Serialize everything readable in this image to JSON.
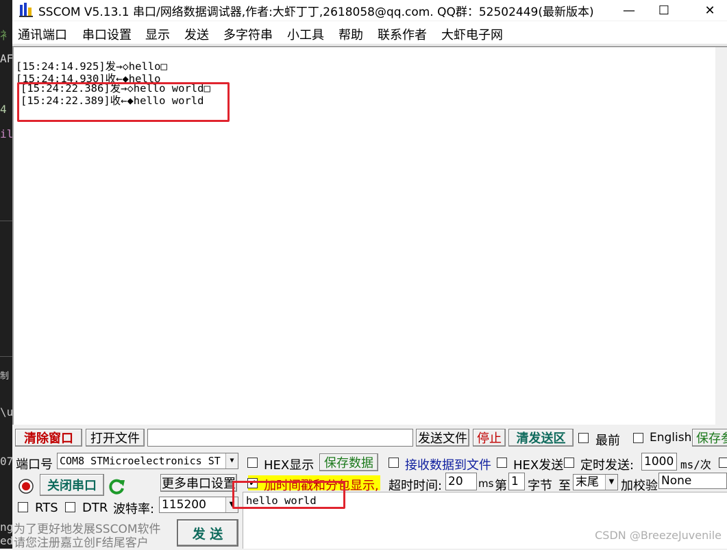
{
  "window": {
    "title": "SSCOM V5.13.1 串口/网络数据调试器,作者:大虾丁丁,2618058@qq.com. QQ群：52502449(最新版本)",
    "minimize_glyph": "—",
    "maximize_glyph": "☐",
    "close_glyph": "✕"
  },
  "menu": {
    "items": [
      "通讯端口",
      "串口设置",
      "显示",
      "发送",
      "多字符串",
      "小工具",
      "帮助",
      "联系作者",
      "大虾电子网"
    ]
  },
  "editor_strip": {
    "fragments": [
      "衤",
      "AF",
      "4",
      "il",
      "制",
      "\\u",
      "07",
      "ng",
      "ed"
    ]
  },
  "receive": {
    "lines": [
      "[15:24:14.925]发→◇hello□",
      "[15:24:14.930]收←◆hello",
      "[15:24:22.386]发→◇hello world□",
      "[15:24:22.389]收←◆hello world"
    ]
  },
  "toolbar": {
    "clear_window": "清除窗口",
    "open_file": "打开文件",
    "file_path": "",
    "send_file": "发送文件",
    "stop": "停止",
    "clear_send": "清发送区",
    "topmost": "最前",
    "english": "English",
    "save_params": "保存参"
  },
  "port": {
    "port_label": "端口号",
    "port_value": "COM8 STMicroelectronics ST",
    "close_port": "关闭串口",
    "more_settings": "更多串口设置",
    "rts": "RTS",
    "dtr": "DTR",
    "baud_label": "波特率:",
    "baud_value": "115200"
  },
  "options": {
    "hex_display": "HEX显示",
    "save_data": "保存数据",
    "recv_to_file": "接收数据到文件",
    "hex_send": "HEX发送",
    "timed_send": "定时发送:",
    "interval": "1000",
    "interval_unit": "ms/次",
    "timestamp": "加时间戳和分包显示,",
    "timeout_label": "超时时间:",
    "timeout_value": "20",
    "timeout_unit": "ms",
    "byte_prefix": "第",
    "byte_index": "1",
    "byte_suffix": "字节",
    "to_label": "至",
    "end_value": "末尾",
    "checksum_label": "加校验",
    "checksum_value": "None"
  },
  "send": {
    "text": "hello world",
    "send_button": "发  送"
  },
  "promo": {
    "line1": "为了更好地发展SSCOM软件",
    "line2": "请您注册嘉立创F结尾客户"
  },
  "watermark": "CSDN @BreezeJuvenile",
  "colors": {
    "highlight_box": "#e0242e",
    "timestamp_bg": "#ffff00",
    "green_text": "#1d7a1d",
    "red_text": "#c00000"
  }
}
